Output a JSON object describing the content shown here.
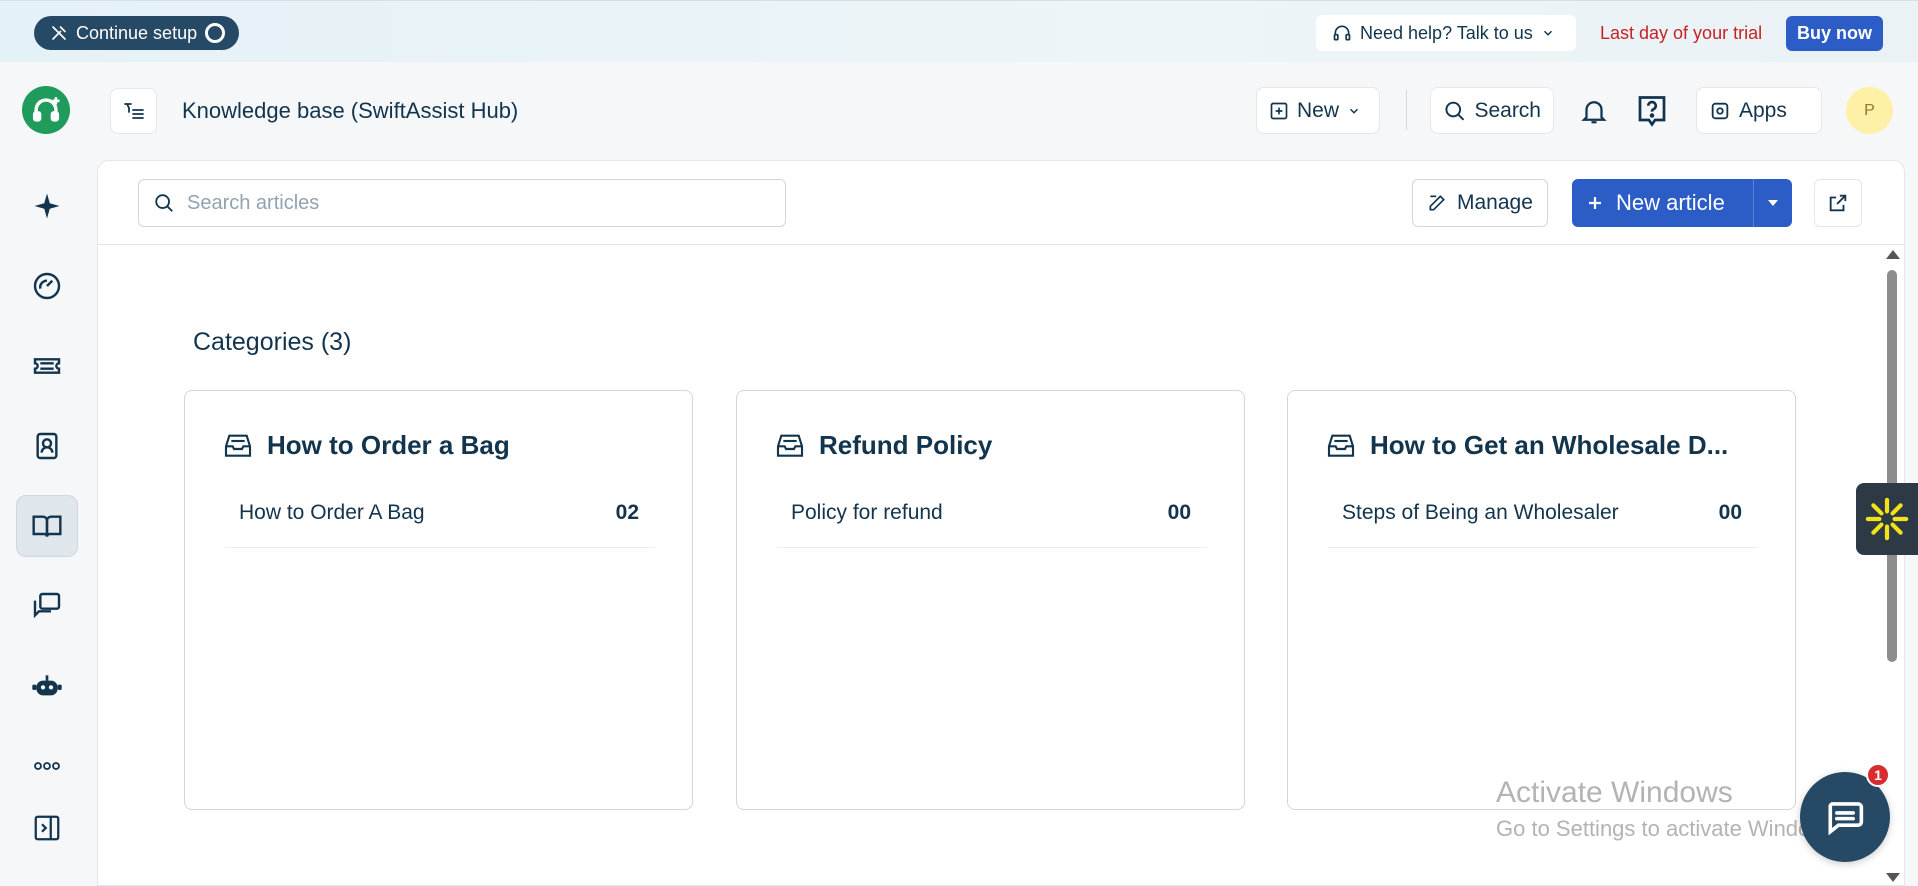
{
  "banner": {
    "continue_setup": "Continue setup",
    "need_help": "Need help? Talk to us",
    "trial_notice": "Last day of your trial",
    "buy_now": "Buy now"
  },
  "header": {
    "title": "Knowledge base (SwiftAssist Hub)",
    "new_label": "New",
    "search_label": "Search",
    "apps_label": "Apps",
    "avatar_initial": "P"
  },
  "rail": {
    "items": [
      "freddy-ai",
      "dashboard",
      "tickets",
      "contacts",
      "knowledge-base",
      "conversations",
      "bot",
      "more",
      "expand"
    ],
    "active": "knowledge-base"
  },
  "toolbar": {
    "search_placeholder": "Search articles",
    "manage_label": "Manage",
    "new_article_label": "New article"
  },
  "categories": {
    "title": "Categories (3)",
    "cards": [
      {
        "name": "How to Order a Bag",
        "folders": [
          {
            "name": "How to Order A Bag",
            "count": "02"
          }
        ]
      },
      {
        "name": "Refund Policy",
        "folders": [
          {
            "name": "Policy for refund",
            "count": "00"
          }
        ]
      },
      {
        "name": "How to Get an Wholesale D...",
        "folders": [
          {
            "name": "Steps of Being an Wholesaler",
            "count": "00"
          }
        ]
      }
    ]
  },
  "chat": {
    "badge_count": "1"
  },
  "watermark": {
    "line1": "Activate Windows",
    "line2": "Go to Settings to activate Windows."
  },
  "colors": {
    "brand_blue": "#2c5cc5",
    "navy": "#264966",
    "logo_green": "#1f9c5c",
    "trial_red": "#c82124"
  }
}
